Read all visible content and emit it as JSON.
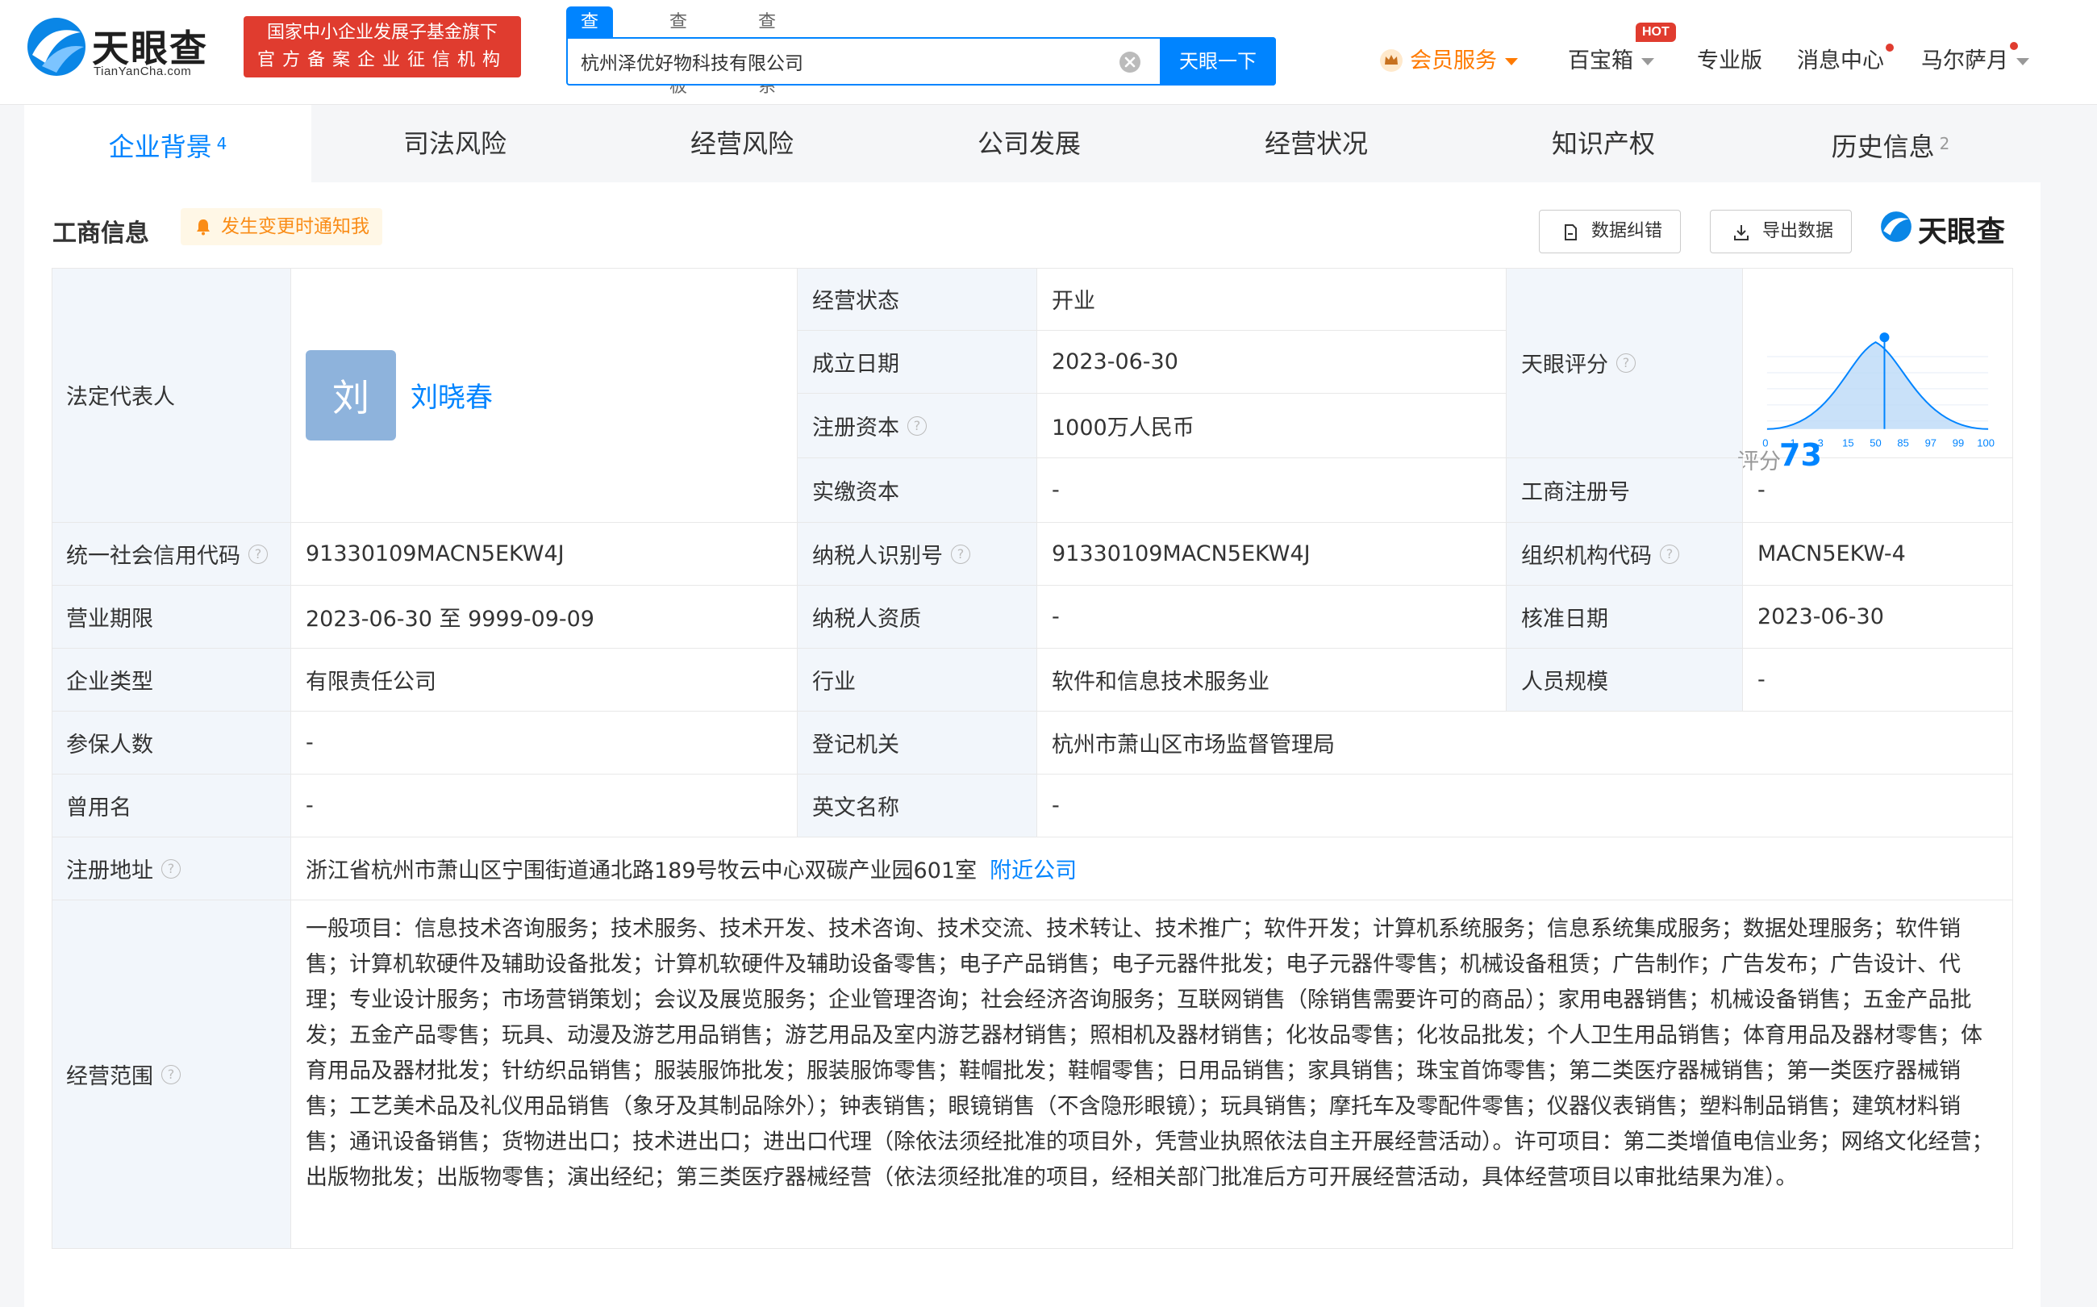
{
  "header": {
    "logo_text": "天眼查",
    "logo_sub": "TianYanCha.com",
    "gov_badge_line1": "国家中小企业发展子基金旗下",
    "gov_badge_line2": "官方备案企业征信机构",
    "search_tabs": [
      "查公司",
      "查老板",
      "查关系"
    ],
    "search_value": "杭州泽优好物科技有限公司",
    "search_button": "天眼一下",
    "vip": "会员服务",
    "baibao": "百宝箱",
    "hot": "HOT",
    "pro": "专业版",
    "messages": "消息中心",
    "user": "马尔萨月"
  },
  "tabs": [
    {
      "label": "企业背景",
      "count": "4"
    },
    {
      "label": "司法风险",
      "count": ""
    },
    {
      "label": "经营风险",
      "count": ""
    },
    {
      "label": "公司发展",
      "count": ""
    },
    {
      "label": "经营状况",
      "count": ""
    },
    {
      "label": "知识产权",
      "count": ""
    },
    {
      "label": "历史信息",
      "count": "2"
    }
  ],
  "section": {
    "title": "工商信息",
    "notify": "发生变更时通知我",
    "correct_btn": "数据纠错",
    "export_btn": "导出数据",
    "brand": "天眼查"
  },
  "info": {
    "legal_rep_label": "法定代表人",
    "legal_rep_avatar": "刘",
    "legal_rep_name": "刘晓春",
    "status_label": "经营状态",
    "status": "开业",
    "founded_label": "成立日期",
    "founded": "2023-06-30",
    "reg_capital_label": "注册资本",
    "reg_capital": "1000万人民币",
    "paid_capital_label": "实缴资本",
    "paid_capital": "-",
    "tianyan_score_label": "天眼评分",
    "score_word": "评分",
    "score": "73",
    "reg_no_label": "工商注册号",
    "reg_no": "-",
    "credit_code_label": "统一社会信用代码",
    "credit_code": "91330109MACN5EKW4J",
    "taxpayer_id_label": "纳税人识别号",
    "taxpayer_id": "91330109MACN5EKW4J",
    "org_code_label": "组织机构代码",
    "org_code": "MACN5EKW-4",
    "term_label": "营业期限",
    "term": "2023-06-30 至 9999-09-09",
    "taxpayer_qual_label": "纳税人资质",
    "taxpayer_qual": "-",
    "approval_label": "核准日期",
    "approval": "2023-06-30",
    "type_label": "企业类型",
    "type": "有限责任公司",
    "industry_label": "行业",
    "industry": "软件和信息技术服务业",
    "staff_label": "人员规模",
    "staff": "-",
    "insured_label": "参保人数",
    "insured": "-",
    "authority_label": "登记机关",
    "authority": "杭州市萧山区市场监督管理局",
    "former_name_label": "曾用名",
    "former_name": "-",
    "english_name_label": "英文名称",
    "english_name": "-",
    "address_label": "注册地址",
    "address": "浙江省杭州市萧山区宁围街道通北路189号牧云中心双碳产业园601室",
    "nearby": "附近公司",
    "scope_label": "经营范围",
    "scope": "一般项目：信息技术咨询服务；技术服务、技术开发、技术咨询、技术交流、技术转让、技术推广；软件开发；计算机系统服务；信息系统集成服务；数据处理服务；软件销售；计算机软硬件及辅助设备批发；计算机软硬件及辅助设备零售；电子产品销售；电子元器件批发；电子元器件零售；机械设备租赁；广告制作；广告发布；广告设计、代理；专业设计服务；市场营销策划；会议及展览服务；企业管理咨询；社会经济咨询服务；互联网销售（除销售需要许可的商品）；家用电器销售；机械设备销售；五金产品批发；五金产品零售；玩具、动漫及游艺用品销售；游艺用品及室内游艺器材销售；照相机及器材销售；化妆品零售；化妆品批发；个人卫生用品销售；体育用品及器材零售；体育用品及器材批发；针纺织品销售；服装服饰批发；服装服饰零售；鞋帽批发；鞋帽零售；日用品销售；家具销售；珠宝首饰零售；第二类医疗器械销售；第一类医疗器械销售；工艺美术品及礼仪用品销售（象牙及其制品除外）；钟表销售；眼镜销售（不含隐形眼镜）；玩具销售；摩托车及零配件零售；仪器仪表销售；塑料制品销售；建筑材料销售；通讯设备销售；货物进出口；技术进出口；进出口代理（除依法须经批准的项目外，凭营业执照依法自主开展经营活动）。许可项目：第二类增值电信业务；网络文化经营；出版物批发；出版物零售；演出经纪；第三类医疗器械经营（依法须经批准的项目，经相关部门批准后方可开展经营活动，具体经营项目以审批结果为准）。"
  },
  "score_axis": [
    "0",
    "1",
    "3",
    "15",
    "50",
    "85",
    "97",
    "99",
    "100"
  ],
  "colors": {
    "brand_blue": "#0084ff",
    "badge_red": "#e03c2f",
    "label_bg": "#f2f6fb",
    "vip_orange": "#ff7a00"
  }
}
